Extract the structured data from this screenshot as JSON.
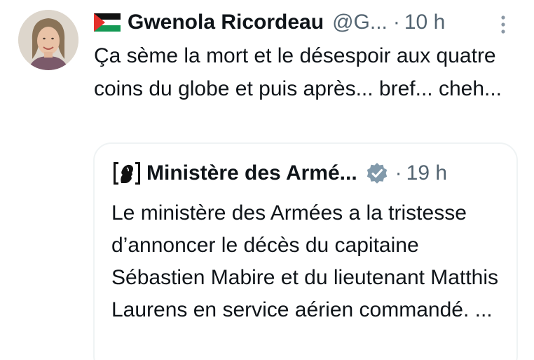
{
  "tweet": {
    "author_name": "Gwenola Ricordeau",
    "handle": "@G...",
    "separator": "·",
    "time": "10 h",
    "text": "Ça sème la mort et le désespoir aux quatre coins du globe et puis après... bref... cheh...",
    "author_flag_icon": "palestine-flag-icon",
    "more_icon": "vertical-ellipsis-icon"
  },
  "quoted_tweet": {
    "author_name": "Ministère des Armé...",
    "separator": "·",
    "time": "19 h",
    "text": "Le ministère des Armées a la tristesse d’annoncer le décès du capitaine Sébastien Mabire et du lieutenant Matthis Laurens en service aérien commandé. ...",
    "logo_icon": "marianne-logo-icon",
    "verified_icon": "verified-badge-icon"
  },
  "colors": {
    "text_primary": "#0f1419",
    "text_secondary": "#536471",
    "border": "#eff3f4",
    "verified_badge": "#829aab"
  }
}
